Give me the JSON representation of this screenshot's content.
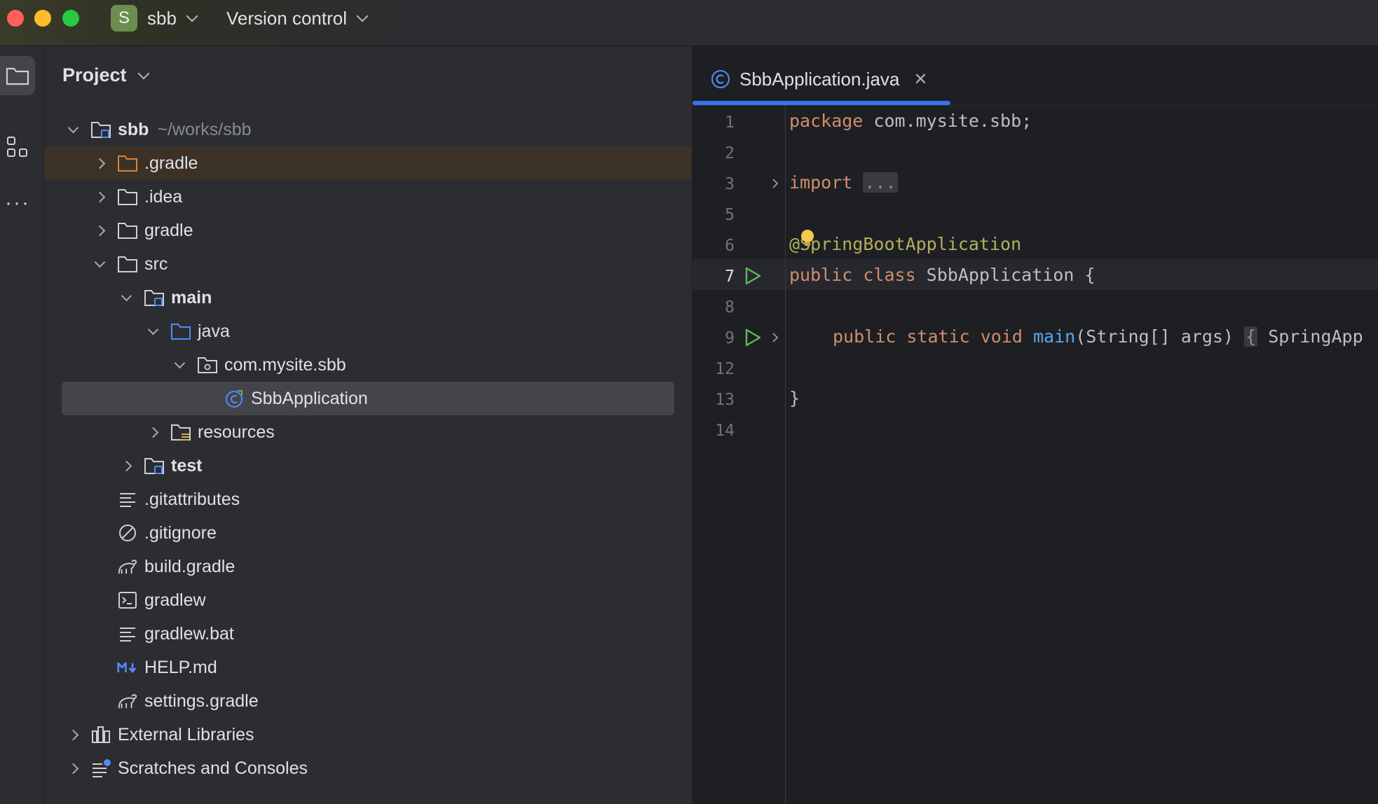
{
  "titlebar": {
    "project_badge": "S",
    "project_name": "sbb",
    "vcs_label": "Version control"
  },
  "panel": {
    "title": "Project"
  },
  "tree": {
    "root": {
      "name": "sbb",
      "path": "~/works/sbb"
    },
    "gradle_hidden": ".gradle",
    "idea": ".idea",
    "gradle": "gradle",
    "src": "src",
    "main": "main",
    "java": "java",
    "package": "com.mysite.sbb",
    "app_class": "SbbApplication",
    "resources": "resources",
    "test": "test",
    "gitattributes": ".gitattributes",
    "gitignore": ".gitignore",
    "build_gradle": "build.gradle",
    "gradlew": "gradlew",
    "gradlew_bat": "gradlew.bat",
    "help_md": "HELP.md",
    "settings_gradle": "settings.gradle",
    "external_libraries": "External Libraries",
    "scratches": "Scratches and Consoles"
  },
  "editor": {
    "tab_label": "SbbApplication.java",
    "line_numbers": [
      "1",
      "2",
      "3",
      "5",
      "6",
      "7",
      "8",
      "9",
      "12",
      "13",
      "14"
    ],
    "code": {
      "l1_kw": "package",
      "l1_rest": " com.mysite.sbb;",
      "l3_kw": "import",
      "l3_fold": "...",
      "l6_ann": "@SpringBootApplication",
      "l7_kw": "public class",
      "l7_rest": " SbbApplication {",
      "l9_kw": "public static void",
      "l9_fn": "main",
      "l9_rest": "(String[] args)",
      "l9_fold": "{",
      "l9_tail": "SpringApp",
      "l13": "}"
    }
  }
}
